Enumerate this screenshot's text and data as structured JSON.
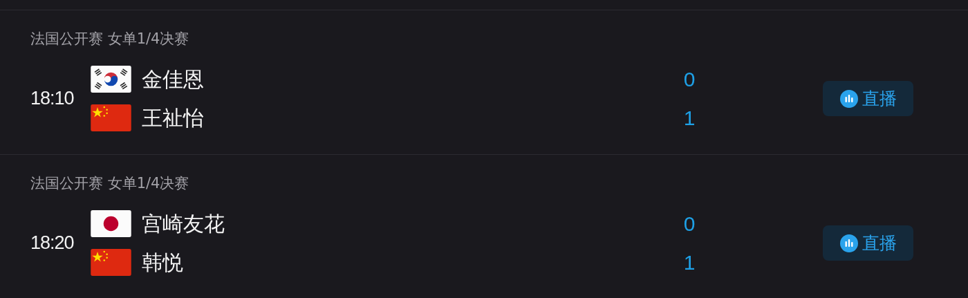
{
  "matches": [
    {
      "title": "法国公开赛 女单1/4决赛",
      "time": "18:10",
      "players": [
        {
          "kind": "korea",
          "name": "金佳恩",
          "score": "0"
        },
        {
          "kind": "china",
          "name": "王祉怡",
          "score": "1"
        }
      ],
      "live_button": "直播"
    },
    {
      "title": "法国公开赛 女单1/4决赛",
      "time": "18:20",
      "players": [
        {
          "kind": "japan",
          "name": "宫崎友花",
          "score": "0"
        },
        {
          "kind": "china",
          "name": "韩悦",
          "score": "1"
        }
      ],
      "live_button": "直播"
    }
  ]
}
